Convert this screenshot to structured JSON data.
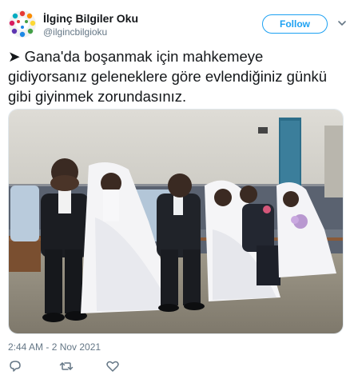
{
  "account": {
    "display_name": "İlginç Bilgiler Oku",
    "handle": "@ilgincbilgioku",
    "avatar_icon": "colorful-circle-logo"
  },
  "follow_button": {
    "label": "Follow",
    "color": "#1da1f2"
  },
  "tweet": {
    "arrow": "➤",
    "text": " Gana'da boşanmak için mahkemeye gidiyorsanız geleneklere göre evlendiğiniz günkü gibi giyinmek zorundasınız."
  },
  "photo": {
    "icon": "photo-three-couples-in-wedding-attire"
  },
  "timestamp": "2:44 AM - 2 Nov 2021",
  "actions": [
    {
      "name": "reply-icon"
    },
    {
      "name": "retweet-icon"
    },
    {
      "name": "like-icon"
    }
  ]
}
